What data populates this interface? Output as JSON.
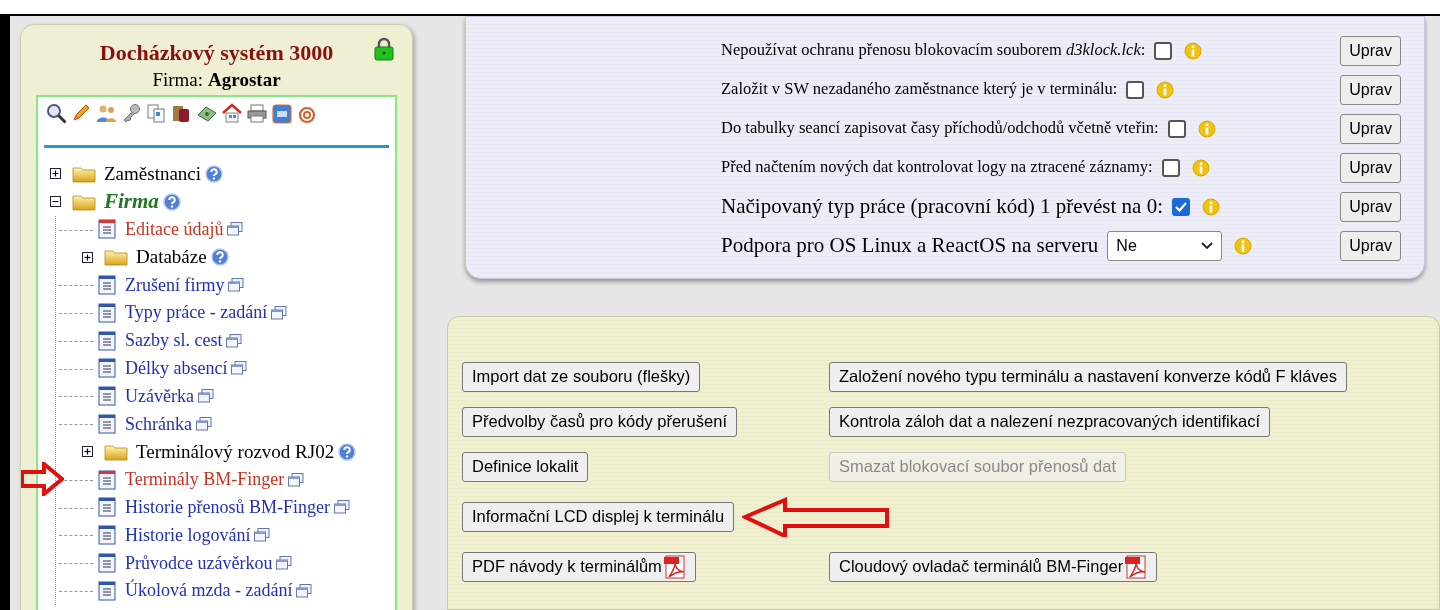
{
  "sidebar": {
    "title": "Docházkový systém 3000",
    "locked": true,
    "company_label": "Firma:",
    "company": "Agrostar",
    "tree": [
      {
        "kind": "folder",
        "label": "Zaměstnanci",
        "expanded": false,
        "help": true
      },
      {
        "kind": "folder",
        "label": "Firma",
        "expanded": true,
        "help": true,
        "children": [
          {
            "kind": "page",
            "label": "Editace údajů",
            "highlighted": true,
            "marked": false
          },
          {
            "kind": "folder",
            "label": "Databáze",
            "expanded": false,
            "help": true
          },
          {
            "kind": "page",
            "label": "Zrušení firmy",
            "highlighted": false,
            "marked": false
          },
          {
            "kind": "page",
            "label": "Typy práce - zadání",
            "highlighted": false,
            "marked": false
          },
          {
            "kind": "page",
            "label": "Sazby sl. cest",
            "highlighted": false,
            "marked": false
          },
          {
            "kind": "page",
            "label": "Délky absencí",
            "highlighted": false,
            "marked": false
          },
          {
            "kind": "page",
            "label": "Uzávěrka",
            "highlighted": false,
            "marked": false
          },
          {
            "kind": "page",
            "label": "Schránka",
            "highlighted": false,
            "marked": false
          },
          {
            "kind": "folder",
            "label": "Terminálový rozvod RJ02",
            "expanded": false,
            "help": true
          },
          {
            "kind": "page",
            "label": "Terminály BM-Finger",
            "highlighted": true,
            "marked": true
          },
          {
            "kind": "page",
            "label": "Historie přenosů BM-Finger",
            "highlighted": false,
            "marked": false
          },
          {
            "kind": "page",
            "label": "Historie logování",
            "highlighted": false,
            "marked": false
          },
          {
            "kind": "page",
            "label": "Průvodce uzávěrkou",
            "highlighted": false,
            "marked": false
          },
          {
            "kind": "page",
            "label": "Úkolová mzda - zadání",
            "highlighted": false,
            "marked": false
          }
        ]
      }
    ]
  },
  "settings": [
    {
      "kind": "checkbox",
      "label": "Nepoužívat ochranu přenosu blokovacím souborem *d3klock.lck*:",
      "checked": false,
      "large": false,
      "button": "Uprav"
    },
    {
      "kind": "checkbox",
      "label": "Založit v SW nezadaného zaměstnance který je v terminálu:",
      "checked": false,
      "large": false,
      "button": "Uprav"
    },
    {
      "kind": "checkbox",
      "label": "Do tabulky seancí zapisovat časy příchodů/odchodů včetně vteřin:",
      "checked": false,
      "large": false,
      "button": "Uprav"
    },
    {
      "kind": "checkbox",
      "label": "Před načtením nových dat kontrolovat logy na ztracené záznamy:",
      "checked": false,
      "large": false,
      "button": "Uprav"
    },
    {
      "kind": "checkbox",
      "label": "Načipovaný typ práce (pracovní kód) 1 převést na 0:",
      "checked": true,
      "large": true,
      "button": "Uprav"
    },
    {
      "kind": "select",
      "label": "Podpora pro OS Linux a ReactOS na serveru",
      "value": "Ne",
      "large": true,
      "button": "Uprav"
    }
  ],
  "actions": [
    [
      {
        "label": "Import dat ze souboru (flešky)",
        "disabled": false,
        "pdf": false,
        "marked": false
      },
      {
        "label": "Založení nového typu terminálu a nastavení konverze kódů F kláves",
        "disabled": false,
        "pdf": false,
        "marked": false
      }
    ],
    [
      {
        "label": "Předvolby časů pro kódy přerušení",
        "disabled": false,
        "pdf": false,
        "marked": false
      },
      {
        "label": "Kontrola záloh dat a nalezení nezpracovaných identifikací",
        "disabled": false,
        "pdf": false,
        "marked": false
      }
    ],
    [
      {
        "label": "Definice lokalit",
        "disabled": false,
        "pdf": false,
        "marked": false
      },
      {
        "label": "Smazat blokovací soubor přenosů dat",
        "disabled": true,
        "pdf": false,
        "marked": false
      }
    ],
    [
      {
        "label": "Informační LCD displej k terminálu",
        "disabled": false,
        "pdf": false,
        "marked": true
      }
    ],
    [
      {
        "label": "PDF návody k terminálům",
        "disabled": false,
        "pdf": true,
        "marked": false
      },
      {
        "label": "Cloudový ovladač terminálů BM-Finger",
        "disabled": false,
        "pdf": true,
        "marked": false
      }
    ]
  ]
}
